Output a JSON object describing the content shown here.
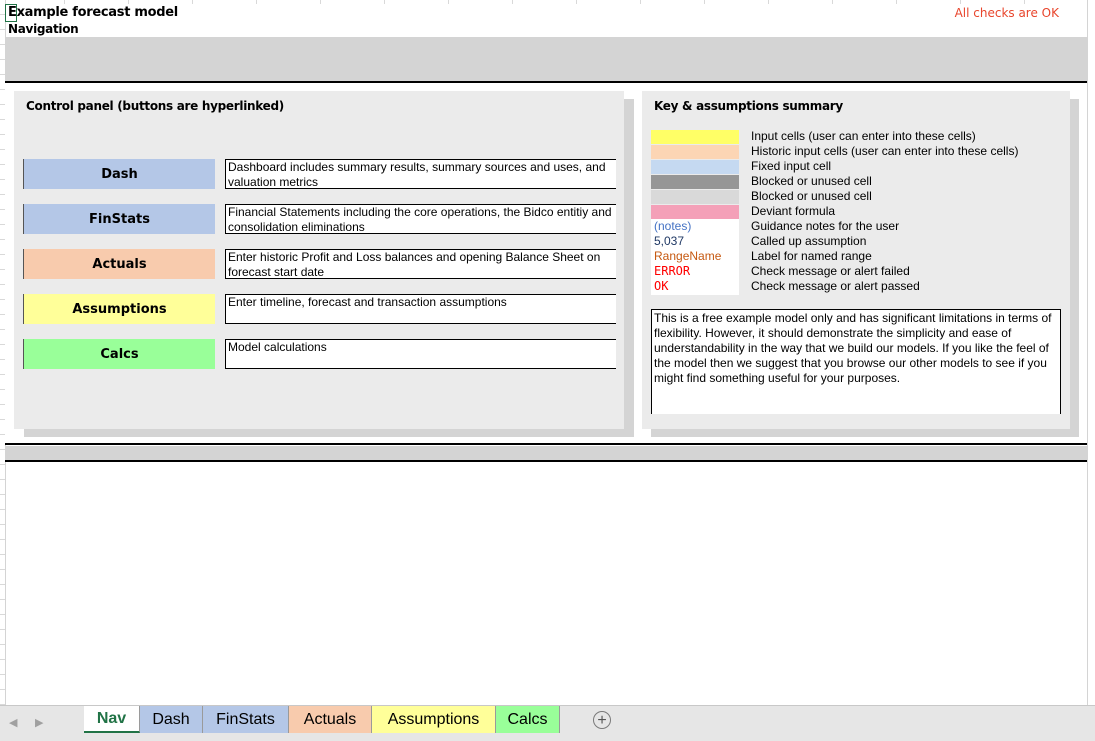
{
  "header": {
    "title": "Example forecast model",
    "subtitle": "Navigation",
    "checks_status": "All checks are OK"
  },
  "control_panel": {
    "title": "Control panel (buttons are hyperlinked)",
    "buttons": [
      {
        "label": "Dash",
        "color": "#b4c7e7",
        "description": "Dashboard includes summary results, summary sources and uses, and valuation metrics"
      },
      {
        "label": "FinStats",
        "color": "#b4c7e7",
        "description": "Financial Statements including the core operations, the Bidco entitiy and consolidation eliminations"
      },
      {
        "label": "Actuals",
        "color": "#f8cbad",
        "description": "Enter historic Profit and Loss balances and opening Balance Sheet on forecast start date"
      },
      {
        "label": "Assumptions",
        "color": "#ffff99",
        "description": "Enter timeline, forecast and transaction assumptions"
      },
      {
        "label": "Calcs",
        "color": "#99ff99",
        "description": "Model calculations"
      }
    ]
  },
  "key": {
    "title": "Key & assumptions summary",
    "items": [
      {
        "swatch": "#ffff66",
        "label": "Input cells (user can enter into these cells)"
      },
      {
        "swatch": "#fcd5b4",
        "label": "Historic input cells (user can enter into these cells)"
      },
      {
        "swatch": "#c5d9f1",
        "label": "Fixed input cell"
      },
      {
        "swatch": "#969696",
        "label": "Blocked or unused cell"
      },
      {
        "swatch": "#d9d9d9",
        "label": "Blocked or unused cell"
      },
      {
        "swatch": "#f4a0b8",
        "label": "Deviant formula"
      },
      {
        "sample": "(notes)",
        "sample_color": "#4472c4",
        "label": "Guidance notes for the user"
      },
      {
        "sample": "5,037",
        "sample_color": "#1f3864",
        "label": "Called up assumption"
      },
      {
        "sample": "RangeName",
        "sample_color": "#c65911",
        "label": "Label for named range"
      },
      {
        "sample": "ERROR",
        "sample_color": "#ff0000",
        "label": "Check message or alert failed"
      },
      {
        "sample": "OK",
        "sample_color": "#ff0000",
        "label": "Check message or alert passed"
      }
    ],
    "notes": "This is a free example model only and has significant limitations in terms of flexibility. However, it should demonstrate the simplicity and ease of understandability in the way that we build our models. If you like the feel of the model then we suggest that you browse our other models to see if you might find something useful for your purposes."
  },
  "tabs": [
    {
      "label": "Nav",
      "active": true,
      "color": "#ffffff"
    },
    {
      "label": "Dash",
      "active": false,
      "color": "#b4c7e7"
    },
    {
      "label": "FinStats",
      "active": false,
      "color": "#b4c7e7"
    },
    {
      "label": "Actuals",
      "active": false,
      "color": "#f8cbad"
    },
    {
      "label": "Assumptions",
      "active": false,
      "color": "#ffff99"
    },
    {
      "label": "Calcs",
      "active": false,
      "color": "#99ff99"
    }
  ],
  "tabbar": {
    "prev_icon": "◀",
    "next_icon": "▶",
    "add_icon": "+"
  }
}
